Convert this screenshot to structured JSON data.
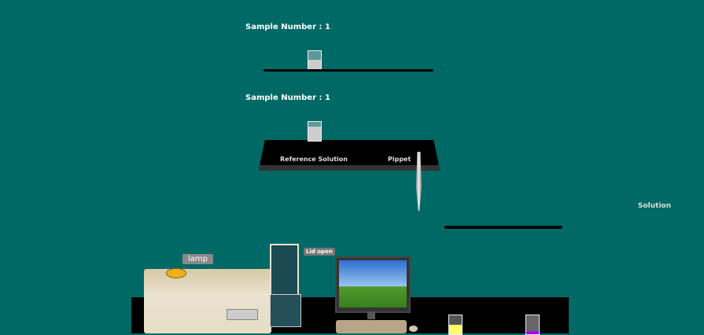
{
  "top_panel": {
    "sample_label": "Sample Number : 1"
  },
  "bottom_panel": {
    "sample_label": "Sample Number : 1",
    "reference_label": "Reference Solution",
    "pipette_label": "Pippet"
  },
  "right": {
    "solution_label": "Solution"
  },
  "instrument": {
    "lamp_label": "lamp",
    "lid_label": "Lid open"
  },
  "colors": {
    "background": "#006966",
    "yellow_solution": "#ffff66",
    "purple_solution": "#9900ff"
  }
}
